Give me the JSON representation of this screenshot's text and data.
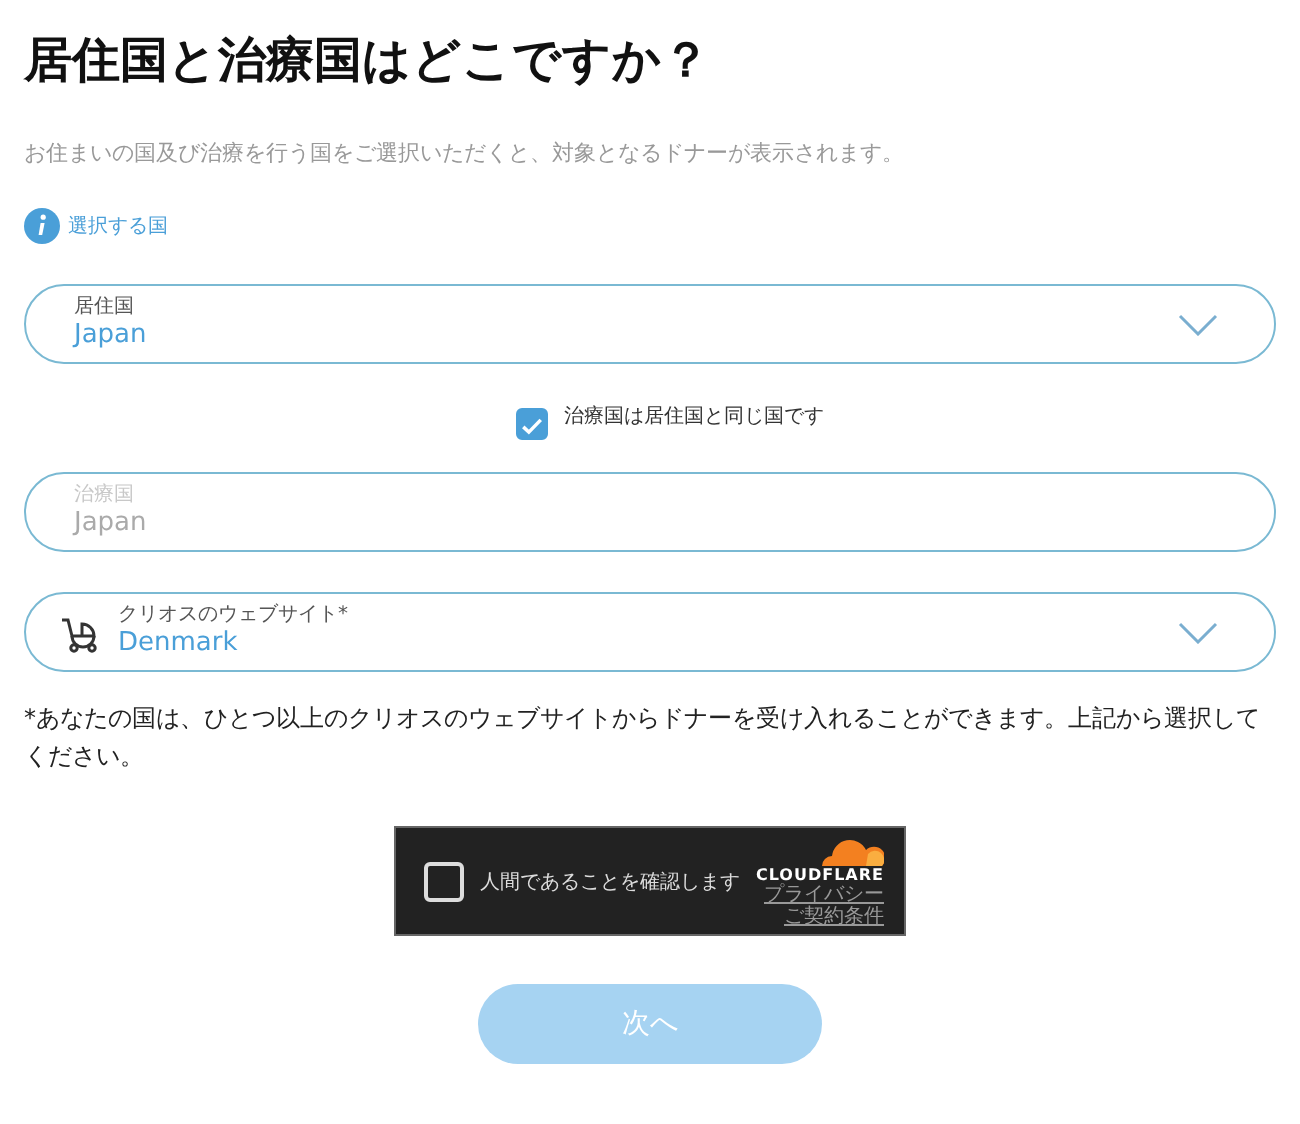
{
  "title": "居住国と治療国はどこですか？",
  "subtitle": "お住まいの国及び治療を行う国をご選択いただくと、対象となるドナーが表示されます。",
  "info_link": "選択する国",
  "fields": [
    {
      "kind": "select",
      "label": "居住国",
      "value": "Japan",
      "disabled": false
    },
    {
      "kind": "checkbox",
      "label": "治療国は居住国と同じ国です",
      "checked": true
    },
    {
      "kind": "input",
      "label": "治療国",
      "value": "Japan",
      "disabled": true
    },
    {
      "kind": "select_icon",
      "label": "クリオスのウェブサイト*",
      "value": "Denmark",
      "disabled": false
    }
  ],
  "note": "*あなたの国は、ひとつ以上のクリオスのウェブサイトからドナーを受け入れることができます。上記から選択してください。",
  "captcha": {
    "label": "人間であることを確認します",
    "checked": false,
    "brand": "CLOUDFLARE",
    "links": [
      "プライバシー",
      "ご契約条件"
    ]
  },
  "next_button": {
    "label": "次へ",
    "disabled": true
  }
}
